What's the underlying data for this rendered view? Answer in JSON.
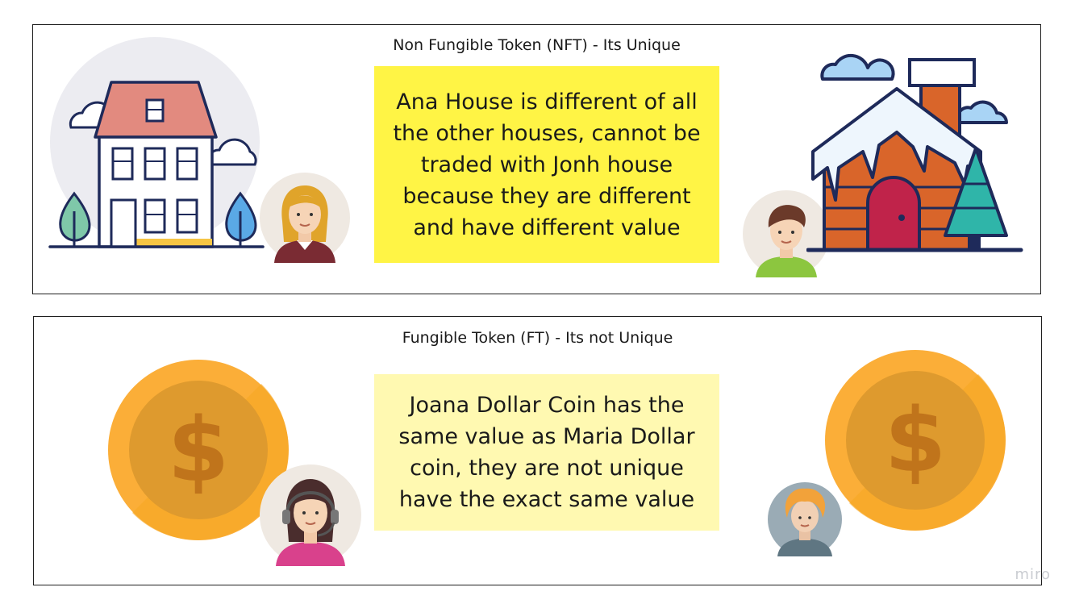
{
  "nft_frame": {
    "title": "Non Fungible Token (NFT) - Its Unique",
    "note": "Ana House is different of all the other houses, cannot be traded with Jonh house because they are different and have different value",
    "note_color": "#fff445"
  },
  "ft_frame": {
    "title": "Fungible Token (FT) - Its not Unique",
    "note": "Joana Dollar Coin has the same value as Maria Dollar coin, they are not unique have the exact same value",
    "note_color": "#fff9b1"
  },
  "icons": [
    "house-icon",
    "cabin-icon",
    "coin-icon",
    "avatar"
  ],
  "colors": {
    "coin": "#f6a723",
    "roof": "#e28a7f",
    "outline": "#1e2a5a",
    "brick": "#d9652a"
  },
  "watermark": "miro"
}
